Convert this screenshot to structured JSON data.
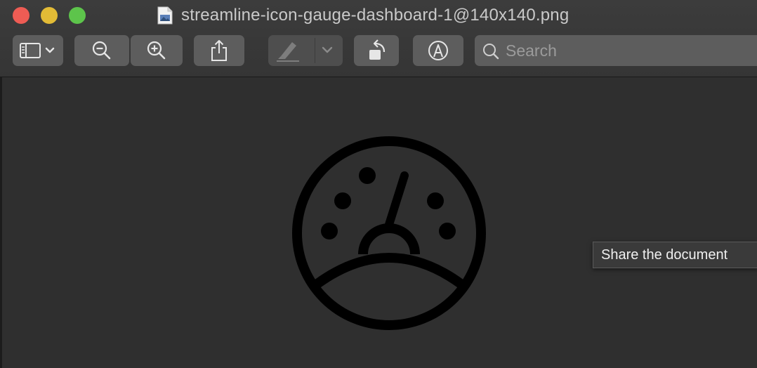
{
  "window": {
    "title": "streamline-icon-gauge-dashboard-1@140x140.png"
  },
  "toolbar": {
    "sidebar_icon": "sidebar-icon",
    "zoom_out_icon": "zoom-out-icon",
    "zoom_in_icon": "zoom-in-icon",
    "share_icon": "share-icon",
    "highlight_icon": "highlighter-icon",
    "rotate_icon": "rotate-icon",
    "markup_icon": "markup-pen-icon"
  },
  "search": {
    "placeholder": "Search"
  },
  "document": {
    "image_icon": "gauge-dashboard-icon"
  },
  "tooltip": {
    "text": "Share the document"
  },
  "colors": {
    "traffic_close": "#ee5c54",
    "traffic_minimize": "#e2bb36",
    "traffic_zoom": "#5dc44b",
    "toolbar_button": "#5d5d5d",
    "canvas": "#2f2f2f"
  }
}
